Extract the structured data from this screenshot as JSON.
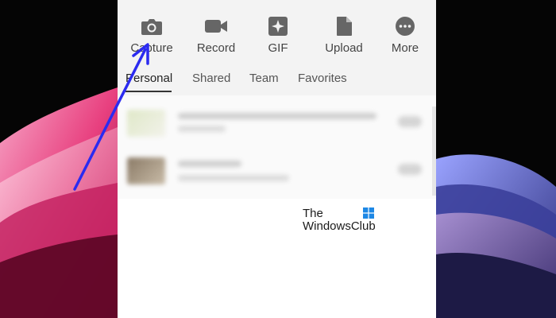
{
  "toolbar": {
    "items": [
      {
        "label": "Capture",
        "icon": "camera-icon"
      },
      {
        "label": "Record",
        "icon": "video-camera-icon"
      },
      {
        "label": "GIF",
        "icon": "sparkle-icon"
      },
      {
        "label": "Upload",
        "icon": "document-icon"
      },
      {
        "label": "More",
        "icon": "more-dots-icon"
      }
    ]
  },
  "tabs": [
    {
      "label": "Personal",
      "active": true
    },
    {
      "label": "Shared",
      "active": false
    },
    {
      "label": "Team",
      "active": false
    },
    {
      "label": "Favorites",
      "active": false
    }
  ],
  "watermark": {
    "line1": "The",
    "line2": "WindowsClub"
  },
  "colors": {
    "arrow": "#2b2bf0",
    "panel": "#ffffff",
    "toolbar_bg": "#f3f3f3",
    "accent_logo": "#1e88e5"
  }
}
